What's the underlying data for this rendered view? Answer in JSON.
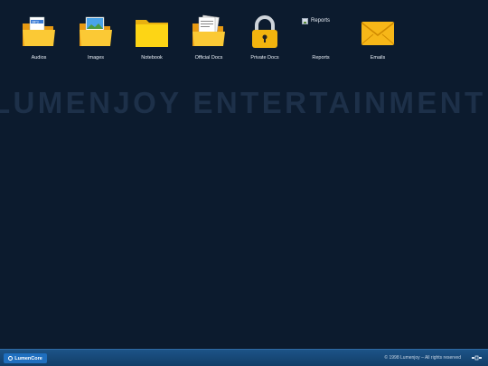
{
  "desktop": {
    "icons": [
      {
        "label": "Audios",
        "icon": "audio-folder-icon"
      },
      {
        "label": "Images",
        "icon": "images-folder-icon"
      },
      {
        "label": "Notebook",
        "icon": "folder-icon"
      },
      {
        "label": "Official Docs",
        "icon": "documents-folder-icon"
      },
      {
        "label": "Private Docs",
        "icon": "padlock-icon"
      },
      {
        "label": "Reports",
        "icon": "broken-image-icon"
      },
      {
        "label": "Emails",
        "icon": "envelope-icon"
      }
    ],
    "broken_image_alt": "Reports",
    "watermark": "LUMENJOY ENTERTAINMENT"
  },
  "taskbar": {
    "start_label": "LumenCore",
    "copyright": "© 1998 Lumenjoy – All rights reserved",
    "tray_icon": "tray-icon"
  },
  "colors": {
    "desktop_bg": "#0c1b2e",
    "taskbar": "#1c5387",
    "folder_yellow": "#f6c21a",
    "start_button": "#1f6fbf"
  }
}
